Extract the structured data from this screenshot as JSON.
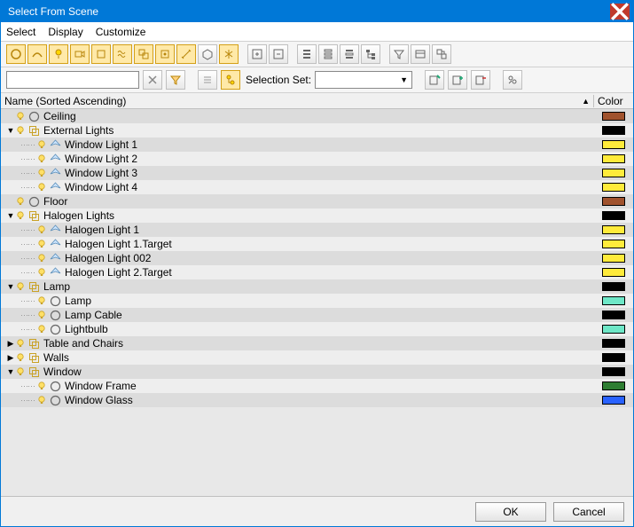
{
  "window": {
    "title": "Select From Scene"
  },
  "menu": {
    "select": "Select",
    "display": "Display",
    "customize": "Customize"
  },
  "selectionSet": {
    "label": "Selection Set:"
  },
  "columns": {
    "name": "Name (Sorted Ascending)",
    "color": "Color"
  },
  "buttons": {
    "ok": "OK",
    "cancel": "Cancel"
  },
  "rows": [
    {
      "depth": 0,
      "exp": "",
      "type": "geom",
      "label": "Ceiling",
      "color": "#a0522d"
    },
    {
      "depth": 0,
      "exp": "down",
      "type": "group",
      "label": "External Lights",
      "color": "#000000"
    },
    {
      "depth": 1,
      "exp": "",
      "type": "light",
      "label": "Window Light 1",
      "color": "#ffeb3b"
    },
    {
      "depth": 1,
      "exp": "",
      "type": "light",
      "label": "Window Light 2",
      "color": "#ffeb3b"
    },
    {
      "depth": 1,
      "exp": "",
      "type": "light",
      "label": "Window Light 3",
      "color": "#ffeb3b"
    },
    {
      "depth": 1,
      "exp": "",
      "type": "light",
      "label": "Window Light 4",
      "color": "#ffeb3b"
    },
    {
      "depth": 0,
      "exp": "",
      "type": "geom",
      "label": "Floor",
      "color": "#a0522d"
    },
    {
      "depth": 0,
      "exp": "down",
      "type": "group",
      "label": "Halogen Lights",
      "color": "#000000"
    },
    {
      "depth": 1,
      "exp": "",
      "type": "light",
      "label": "Halogen Light 1",
      "color": "#ffeb3b"
    },
    {
      "depth": 1,
      "exp": "",
      "type": "light",
      "label": "Halogen Light 1.Target",
      "color": "#ffeb3b"
    },
    {
      "depth": 1,
      "exp": "",
      "type": "light",
      "label": "Halogen Light 002",
      "color": "#ffeb3b"
    },
    {
      "depth": 1,
      "exp": "",
      "type": "light",
      "label": "Halogen Light 2.Target",
      "color": "#ffeb3b"
    },
    {
      "depth": 0,
      "exp": "down",
      "type": "group",
      "label": "Lamp",
      "color": "#000000"
    },
    {
      "depth": 1,
      "exp": "",
      "type": "geom",
      "label": "Lamp",
      "color": "#6ee7c7"
    },
    {
      "depth": 1,
      "exp": "",
      "type": "geom",
      "label": "Lamp Cable",
      "color": "#000000"
    },
    {
      "depth": 1,
      "exp": "",
      "type": "geom",
      "label": "Lightbulb",
      "color": "#6ee7c7"
    },
    {
      "depth": 0,
      "exp": "right",
      "type": "group",
      "label": "Table and Chairs",
      "color": "#000000"
    },
    {
      "depth": 0,
      "exp": "right",
      "type": "group",
      "label": "Walls",
      "color": "#000000"
    },
    {
      "depth": 0,
      "exp": "down",
      "type": "group",
      "label": "Window",
      "color": "#000000"
    },
    {
      "depth": 1,
      "exp": "",
      "type": "geom",
      "label": "Window Frame",
      "color": "#2e7d32"
    },
    {
      "depth": 1,
      "exp": "",
      "type": "geom",
      "label": "Window Glass",
      "color": "#2962ff"
    }
  ]
}
